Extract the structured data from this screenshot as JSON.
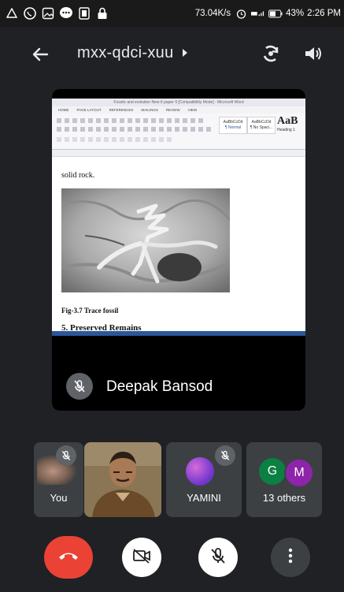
{
  "status_bar": {
    "speed": "73.04K/s",
    "battery": "43%",
    "time": "2:26 PM"
  },
  "header": {
    "meeting_code": "mxx-qdci-xuu",
    "icons": [
      "back-arrow-icon",
      "chevron-right-icon",
      "switch-camera-icon",
      "speaker-icon"
    ]
  },
  "presenter": {
    "name": "Deepak Bansod",
    "mic_muted": true,
    "shared_document": {
      "window_title": "Fossils and evolution New II paper II [Compatibility Mode] - Microsoft Word",
      "menu_tabs": [
        "HOME",
        "PAGE LAYOUT",
        "REFERENCES",
        "MAILINGS",
        "REVIEW",
        "VIEW"
      ],
      "styles": [
        "AaBbCcDd",
        "AaBbCcDd",
        "AaB"
      ],
      "style_names": [
        "¶ Normal",
        "¶ No Spaci...",
        "Heading 1"
      ],
      "text_line": "solid rock.",
      "figure_caption": "Fig-3.7 Trace fossil",
      "section_heading": "5. Preserved Remains"
    }
  },
  "participants": {
    "you_label": "You",
    "yamini_label": "YAMINI",
    "others_label": "13 others",
    "others_avatars": [
      {
        "initial": "G",
        "color": "#0b8043"
      },
      {
        "initial": "M",
        "color": "#8e24aa"
      }
    ]
  },
  "controls": {
    "end_call_color": "#ea4335",
    "icons": [
      "end-call-icon",
      "camera-off-icon",
      "mic-off-icon",
      "more-options-icon"
    ]
  }
}
